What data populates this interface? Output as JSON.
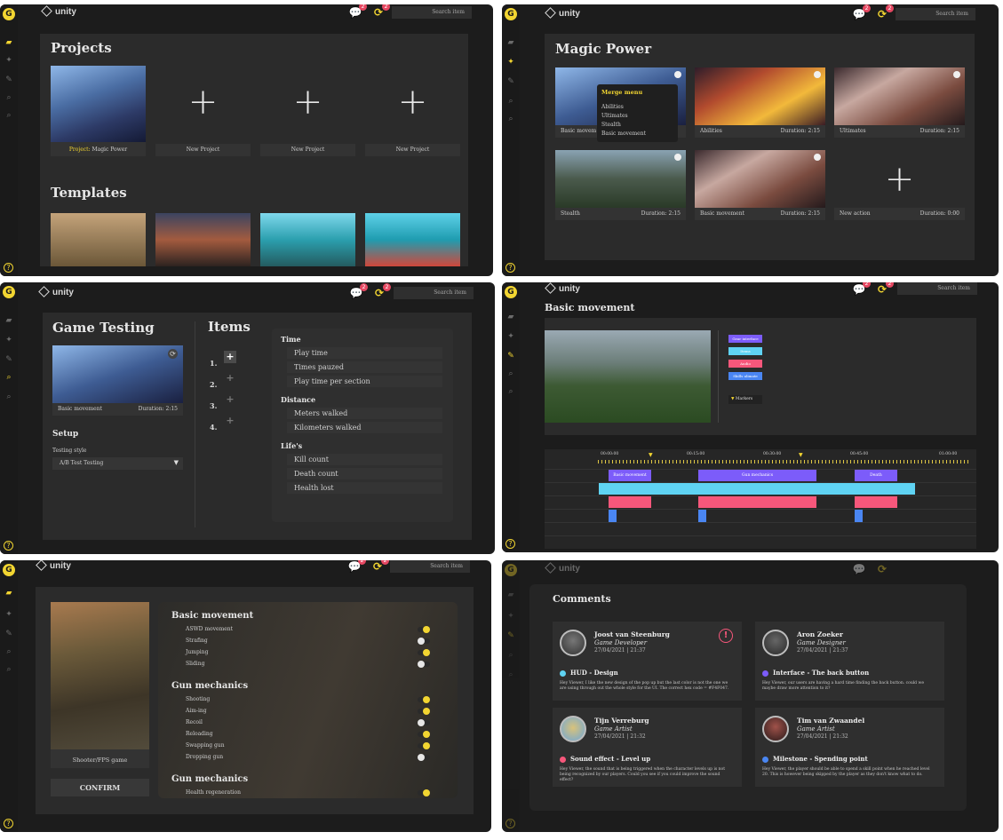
{
  "app": {
    "brand": "unity",
    "logo_letter": "G",
    "search_placeholder": "Search item",
    "notif_count": "2",
    "sync_count": "2"
  },
  "colors": {
    "accent": "#f2d531",
    "badge": "#e64862",
    "purple": "#7c5cfa",
    "cyan": "#5fd3f3",
    "pink": "#f7577b",
    "blue": "#4a86f2"
  },
  "projects": {
    "title": "Projects",
    "project_label": "Project:",
    "project_name": "Magic Power",
    "new_project": "New Project",
    "templates_title": "Templates"
  },
  "magic": {
    "title": "Magic Power",
    "menu_title": "Merge menu",
    "menu_items": [
      "Abilities",
      "Ultimates",
      "Stealth",
      "Basic movement"
    ],
    "cards": [
      {
        "name": "Basic movem",
        "duration": ""
      },
      {
        "name": "Abilities",
        "duration": "Duration: 2:15"
      },
      {
        "name": "Ultimates",
        "duration": "Duration: 2:15"
      },
      {
        "name": "Stealth",
        "duration": "Duration: 2:15"
      },
      {
        "name": "Basic movement",
        "duration": "Duration: 2:15"
      },
      {
        "name": "New action",
        "duration": "Duration: 0:00"
      }
    ]
  },
  "testing": {
    "title": "Game Testing",
    "card_name": "Basic movement",
    "card_duration": "Duration: 2:15",
    "setup": "Setup",
    "style_label": "Testing style",
    "style_value": "A/B Test Testing",
    "items_title": "Items",
    "items": [
      "1.",
      "2.",
      "3.",
      "4."
    ],
    "groups": [
      {
        "title": "Time",
        "rows": [
          "Play time",
          "Times pauzed",
          "Play time per section"
        ]
      },
      {
        "title": "Distance",
        "rows": [
          "Meters walked",
          "Kilometers walked"
        ]
      },
      {
        "title": "Life's",
        "rows": [
          "Kill count",
          "Death count",
          "Health lost"
        ]
      }
    ]
  },
  "timeline": {
    "title": "Basic movement",
    "legend": [
      "Gear interface",
      "Items",
      "Audio",
      "Skills ulimate"
    ],
    "markers": "Markers",
    "times": [
      "00:00:00",
      "00:15:00",
      "00:30:00",
      "00:45:00",
      "01:00:00"
    ],
    "segments": [
      "Basic movement",
      "Gun mechanics",
      "Death"
    ]
  },
  "shooter": {
    "card_label": "Shooter/FPS game",
    "confirm": "CONFIRM",
    "groups": [
      {
        "title": "Basic movement",
        "items": [
          "ASWD movement",
          "Strafing",
          "Jumping",
          "Sliding"
        ]
      },
      {
        "title": "Gun mechanics",
        "items": [
          "Shooting",
          "Aim-ing",
          "Recoil",
          "Reloading",
          "Swapping gun",
          "Dropping gun"
        ]
      },
      {
        "title": "Gun mechanics",
        "items": [
          "Health regeneration"
        ]
      }
    ],
    "toggles": [
      true,
      false,
      true,
      false,
      true,
      true,
      false,
      true,
      true,
      false,
      true
    ]
  },
  "comments": {
    "title": "Comments",
    "items": [
      {
        "name": "Joost van Steenburg",
        "role": "Game Developer",
        "date": "27/04/2021 | 21:37",
        "topic": "HUD - Design",
        "body": "Hey Viewer, I like the new design of the pop up but the last color is not the one we are using through out the whole style for the UI. The correct hex code = #F4F047.",
        "color": "#5fd3f3"
      },
      {
        "name": "Aron Zoeker",
        "role": "Game Designer",
        "date": "27/04/2021 | 21:37",
        "topic": "Interface - The back button",
        "body": "Hey Viewer, our users are having a hard time finding the back button. could we maybe draw more attention to it?",
        "color": "#7c5cfa"
      },
      {
        "name": "Tijn Verreburg",
        "role": "Game Artist",
        "date": "27/04/2021 | 21:32",
        "topic": "Sound effect - Level up",
        "body": "Hey Viewer, the sound that is being triggered when the character levels up is not being recognized by our players. Could you see if you could improve the sound effect?",
        "color": "#f7577b"
      },
      {
        "name": "Tim van Zwaandel",
        "role": "Game Artist",
        "date": "27/04/2021 | 21:32",
        "topic": "Milestone - Spending point",
        "body": "Hey Viewer, the player should be able to spend a skill point when he reached level 20. This is however being skipped by the player as they don't know what to do.",
        "color": "#4a86f2"
      }
    ]
  }
}
